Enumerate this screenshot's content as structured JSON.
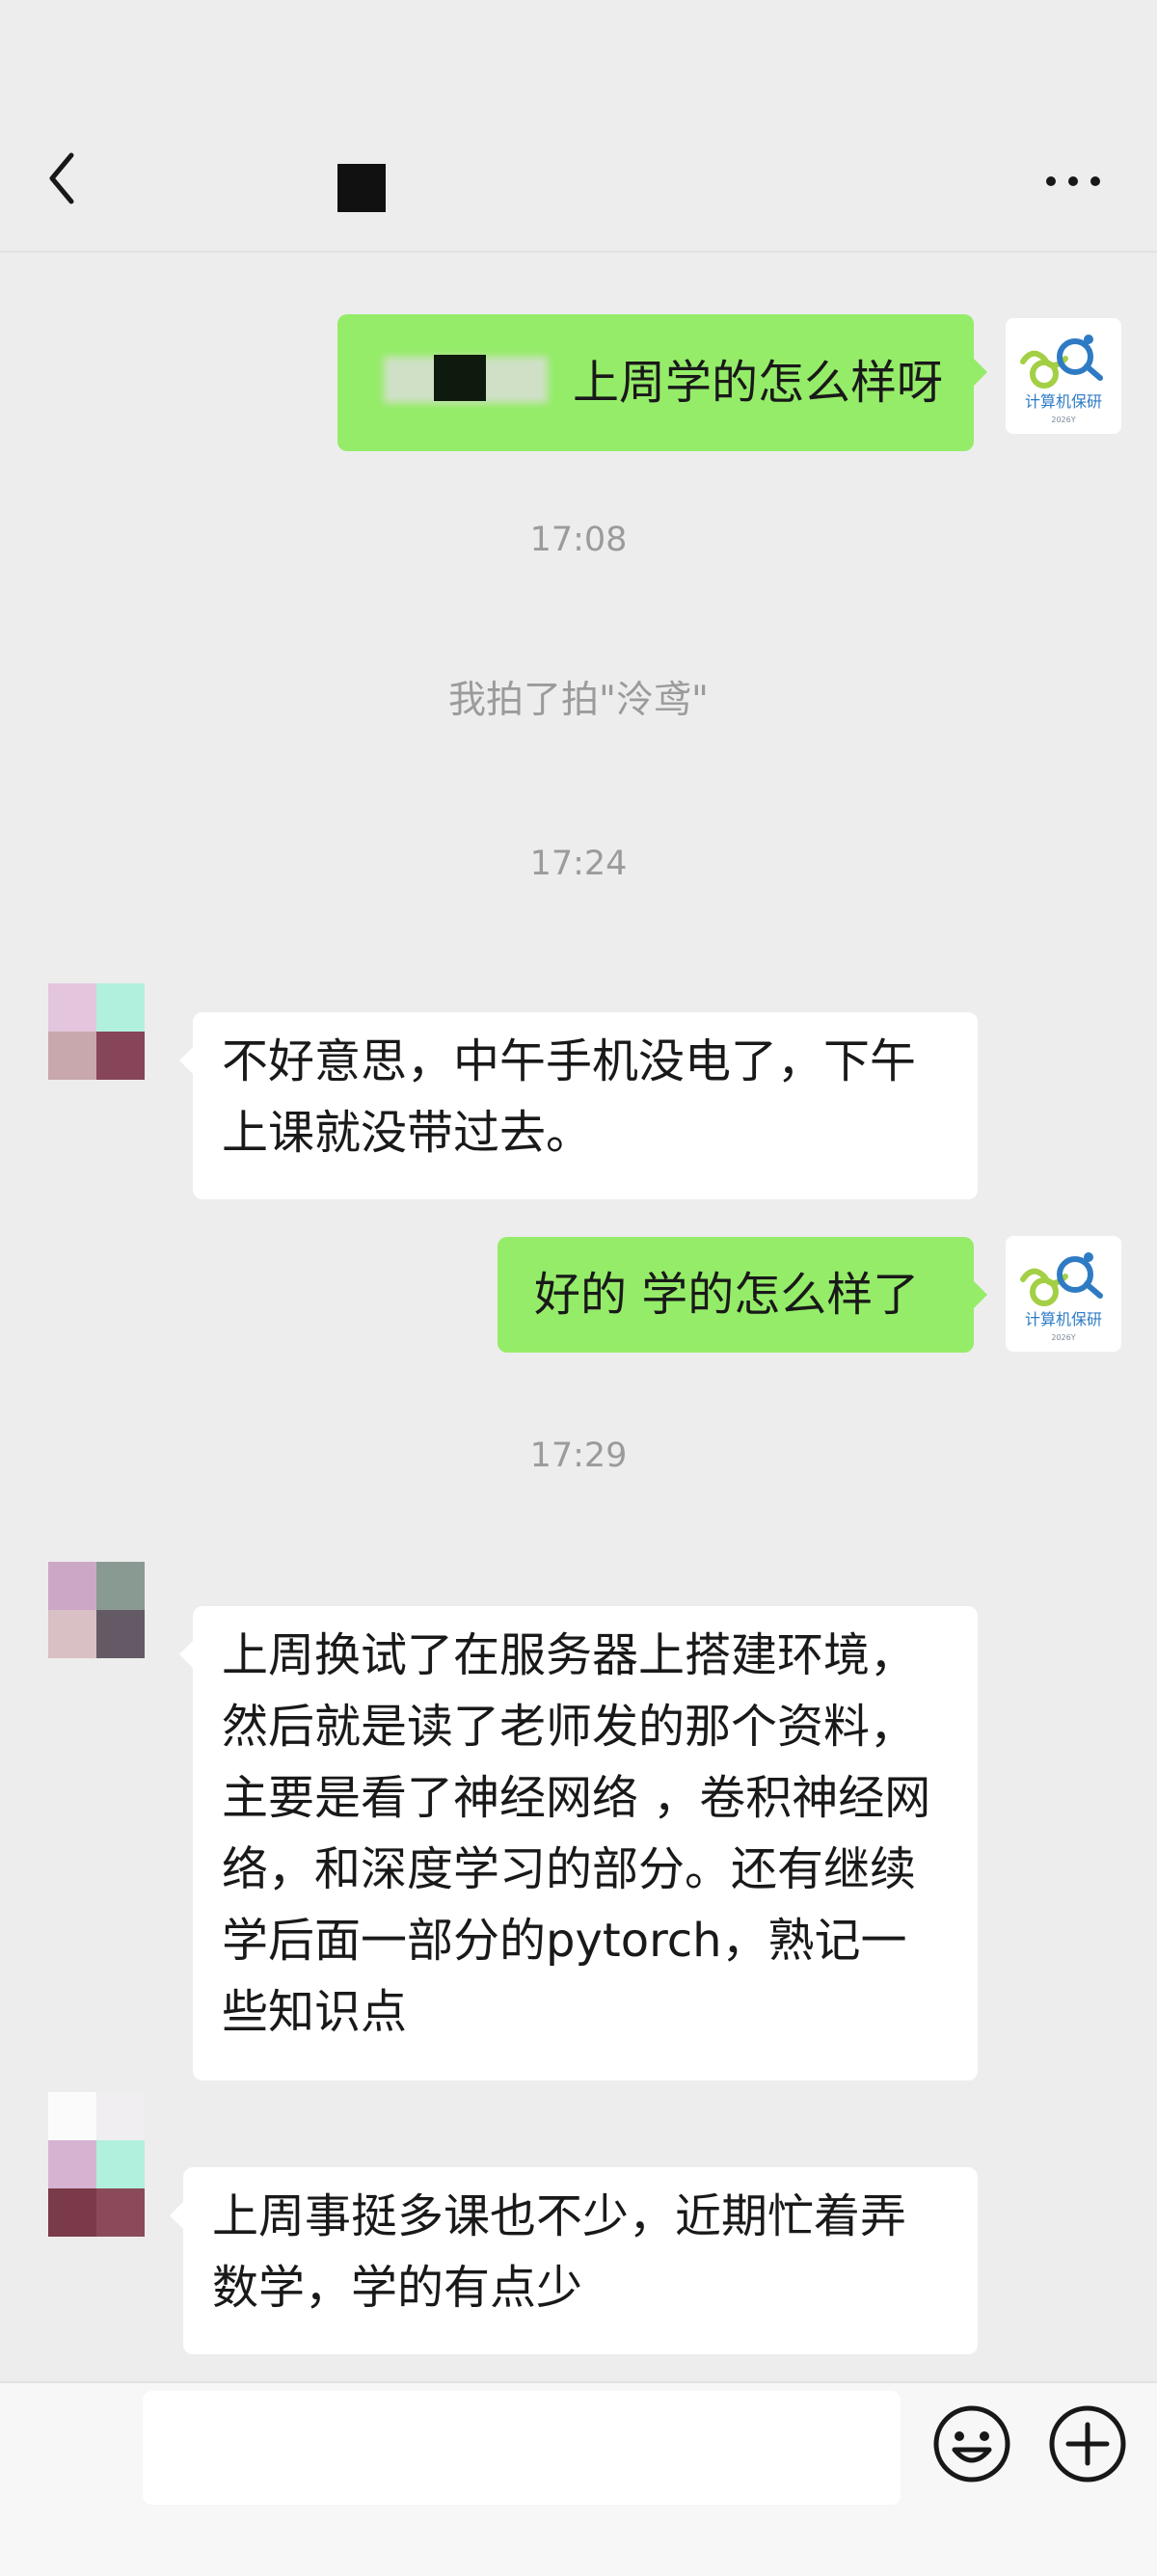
{
  "header": {
    "back_icon": "back-arrow-icon",
    "more_icon": "more-dots-icon"
  },
  "messages": {
    "m1": {
      "text": "上周学的怎么样呀"
    },
    "t1": "17:08",
    "sys1": "我拍了拍\"泠鸢\"",
    "t2": "17:24",
    "m2": {
      "text": "不好意思，中午手机没电了，下午上课就没带过去。"
    },
    "m3": {
      "text": "好的 学的怎么样了"
    },
    "t3": "17:29",
    "m4": {
      "text": "上周换试了在服务器上搭建环境，然后就是读了老师发的那个资料，主要是看了神经网络 ，卷积神经网络，和深度学习的部分。还有继续学后面一部分的pytorch，熟记一些知识点"
    },
    "m5": {
      "text": "上周事挺多课也不少，近期忙着弄数学，学的有点少"
    }
  },
  "self_avatar": {
    "label": "计算机保研",
    "sub": "2026Y"
  },
  "colors": {
    "bg": "#ededed",
    "out_bubble": "#95ec69",
    "in_bubble": "#ffffff",
    "logo_green": "#a3cf45",
    "logo_blue": "#2e7bc4"
  },
  "footer": {
    "emoji_icon": "smile-emoji-icon",
    "plus_icon": "plus-circle-icon"
  }
}
